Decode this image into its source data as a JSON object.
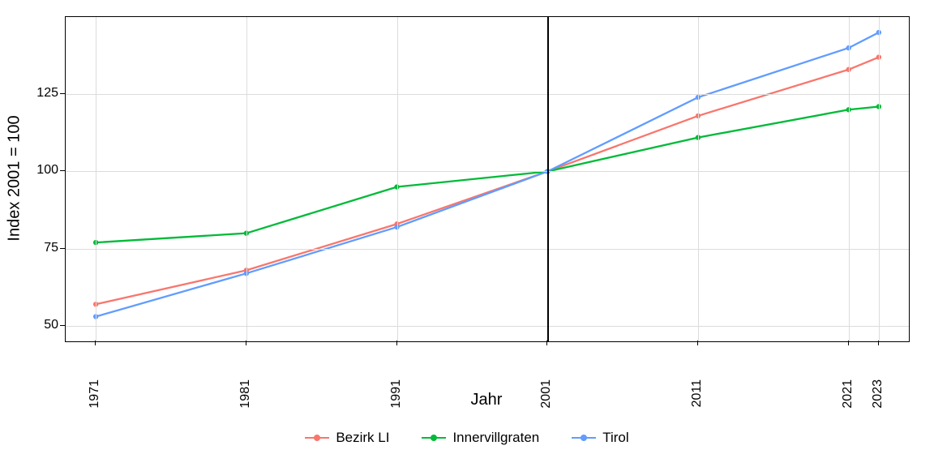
{
  "chart_data": {
    "type": "line",
    "title": "",
    "xlabel": "Jahr",
    "ylabel": "Index 2001 = 100",
    "x": [
      1971,
      1981,
      1991,
      2001,
      2011,
      2021,
      2023
    ],
    "x_ticks": [
      1971,
      1981,
      1991,
      2001,
      2011,
      2021,
      2023
    ],
    "y_ticks": [
      50,
      75,
      100,
      125
    ],
    "xlim": [
      1969,
      2025
    ],
    "ylim": [
      45,
      150
    ],
    "reference_vline_x": 2001,
    "legend_position": "bottom",
    "series": [
      {
        "name": "Bezirk LI",
        "color": "#F8766D",
        "values": [
          57,
          68,
          83,
          100,
          118,
          133,
          137
        ]
      },
      {
        "name": "Innervillgraten",
        "color": "#00BA38",
        "values": [
          77,
          80,
          95,
          100,
          111,
          120,
          121
        ]
      },
      {
        "name": "Tirol",
        "color": "#619CFF",
        "values": [
          53,
          67,
          82,
          100,
          124,
          140,
          145
        ]
      }
    ]
  }
}
